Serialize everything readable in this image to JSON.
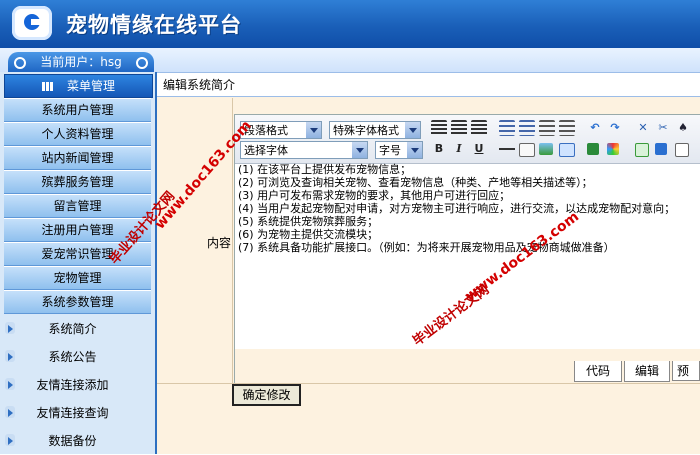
{
  "header": {
    "title": "宠物情缘在线平台",
    "logo_icon": "app-logo-icon"
  },
  "user": {
    "label": "当前用户：hsg"
  },
  "sidebar": {
    "head": "菜单管理",
    "items": [
      {
        "label": "系统用户管理"
      },
      {
        "label": "个人资料管理"
      },
      {
        "label": "站内新闻管理"
      },
      {
        "label": "殡葬服务管理"
      },
      {
        "label": "留言管理"
      },
      {
        "label": "注册用户管理"
      },
      {
        "label": "爱宠常识管理"
      },
      {
        "label": "宠物管理"
      },
      {
        "label": "系统参数管理"
      }
    ],
    "sub_items": [
      {
        "label": "系统简介"
      },
      {
        "label": "系统公告"
      },
      {
        "label": "友情连接添加"
      },
      {
        "label": "友情连接查询"
      },
      {
        "label": "数据备份"
      }
    ]
  },
  "main": {
    "title": "编辑系统简介",
    "field_label": "内容",
    "toolbar": {
      "paragraph_format": "段落格式",
      "special_format": "特殊字体格式",
      "font_family": "选择字体",
      "font_size": "字号"
    },
    "content_lines": [
      "(1) 在该平台上提供发布宠物信息；",
      "(2) 可浏览及查询相关宠物、查看宠物信息（种类、产地等相关描述等）；",
      "(3) 用户可发布需求宠物的要求，其他用户可进行回应；",
      "(4) 当用户发起宠物配对申请，对方宠物主可进行响应，进行交流，以达成宠物配对意向；",
      "(5) 系统提供宠物殡葬服务；",
      "(6) 为宠物主提供交流模块；",
      "(7) 系统具备功能扩展接口。（例如：为将来开展宠物用品及宠物商城做准备）"
    ],
    "modes": [
      "代码",
      "编辑",
      "预览"
    ],
    "submit": "确定修改"
  },
  "watermarks": {
    "url": "www.doc163.com",
    "text": "毕业设计论文网"
  },
  "colors": {
    "header": "#1a5fb8",
    "sidebar": "#d8e8f8",
    "content_bg": "#fdf2e0",
    "watermark": "#d40000"
  }
}
